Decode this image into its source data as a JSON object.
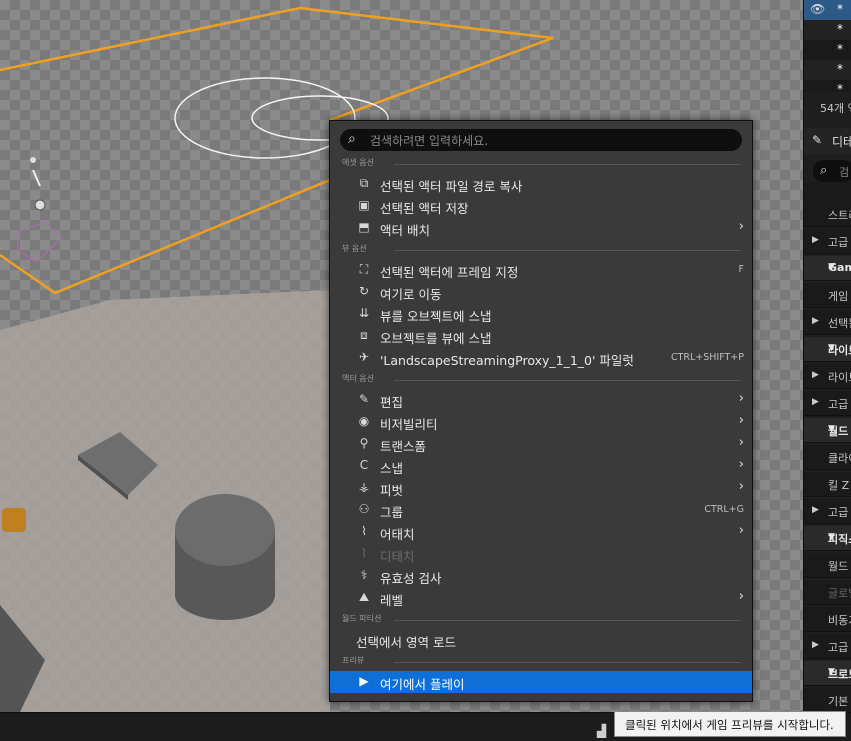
{
  "menu": {
    "search_placeholder": "검색하려면 입력하세요.",
    "sections": [
      {
        "header": "에셋 옵션",
        "items": [
          {
            "icon": "copy-path-icon",
            "glyph": "⧉",
            "label": "선택된 액터 파일 경로 복사"
          },
          {
            "icon": "save-icon",
            "glyph": "▣",
            "label": "선택된 액터 저장"
          },
          {
            "icon": "place-actor-icon",
            "glyph": "⬒",
            "label": "액터 배치",
            "submenu": true
          }
        ]
      },
      {
        "header": "뷰 옵션",
        "items": [
          {
            "icon": "frame-icon",
            "glyph": "⛶",
            "label": "선택된 액터에 프레임 지정",
            "shortcut": "F"
          },
          {
            "icon": "move-here-icon",
            "glyph": "↻",
            "label": "여기로 이동"
          },
          {
            "icon": "snap-object-to-view-icon",
            "glyph": "⇊",
            "label": "뷰를 오브젝트에 스냅"
          },
          {
            "icon": "snap-view-to-object-icon",
            "glyph": "⧈",
            "label": "오브젝트를 뷰에 스냅"
          },
          {
            "icon": "pilot-icon",
            "glyph": "✈",
            "label": "'LandscapeStreamingProxy_1_1_0' 파일럿",
            "shortcut": "CTRL+SHIFT+P"
          }
        ]
      },
      {
        "header": "액터 옵션",
        "items": [
          {
            "icon": "edit-icon",
            "glyph": "✎",
            "label": "편집",
            "submenu": true
          },
          {
            "icon": "visibility-icon",
            "glyph": "◉",
            "label": "비저빌리티",
            "submenu": true
          },
          {
            "icon": "transform-icon",
            "glyph": "⚲",
            "label": "트랜스폼",
            "submenu": true
          },
          {
            "icon": "snap-icon",
            "glyph": "C",
            "label": "스냅",
            "submenu": true
          },
          {
            "icon": "pivot-icon",
            "glyph": "⚶",
            "label": "피벗",
            "submenu": true
          },
          {
            "icon": "group-icon",
            "glyph": "⚇",
            "label": "그룹",
            "shortcut": "CTRL+G"
          },
          {
            "icon": "attach-icon",
            "glyph": "⌇",
            "label": "어태치",
            "submenu": true
          },
          {
            "icon": "detach-icon",
            "glyph": "⌇",
            "label": "디태치",
            "disabled": true
          },
          {
            "icon": "validate-icon",
            "glyph": "⚕",
            "label": "유효성 검사"
          },
          {
            "icon": "level-icon",
            "glyph": "⛰",
            "label": "레벨",
            "submenu": true
          }
        ]
      },
      {
        "header": "월드 파티션",
        "items": [
          {
            "label": "선택에서 영역 로드",
            "plain": true
          }
        ]
      },
      {
        "header": "프리뷰",
        "items": [
          {
            "icon": "play-icon",
            "glyph": "▶",
            "label": "여기에서 플레이",
            "highlighted": true
          }
        ]
      }
    ]
  },
  "tooltip": "클릭된 위치에서 게임 프리뷰를 시작합니다.",
  "right_panel": {
    "outliner_star": "*",
    "count_text": "54개 액",
    "details_tab": "디테",
    "search_placeholder": "검",
    "properties": [
      {
        "label": "",
        "kind": "sub"
      },
      {
        "label": "스트리",
        "kind": "sub"
      },
      {
        "label": "고급",
        "kind": "collapsed"
      },
      {
        "label": "Game",
        "kind": "cat"
      },
      {
        "label": "게임",
        "kind": "sub"
      },
      {
        "label": "선택됨",
        "kind": "collapsed"
      },
      {
        "label": "라이트",
        "kind": "cat"
      },
      {
        "label": "라이트",
        "kind": "collapsed"
      },
      {
        "label": "고급",
        "kind": "collapsed"
      },
      {
        "label": "월드",
        "kind": "cat"
      },
      {
        "label": "클라이",
        "kind": "sub"
      },
      {
        "label": "킬 Z",
        "kind": "sub"
      },
      {
        "label": "고급",
        "kind": "collapsed"
      },
      {
        "label": "피직스",
        "kind": "cat"
      },
      {
        "label": "월드",
        "kind": "sub"
      },
      {
        "label": "글로벌",
        "kind": "dim"
      },
      {
        "label": "비동기",
        "kind": "sub"
      },
      {
        "label": "고급",
        "kind": "collapsed"
      },
      {
        "label": "브로드",
        "kind": "cat"
      },
      {
        "label": "기본",
        "kind": "sub"
      }
    ]
  },
  "colors": {
    "menu_bg": "#3a3a3a",
    "highlight": "#0e6fd6",
    "selection_outline": "#f0a020"
  }
}
